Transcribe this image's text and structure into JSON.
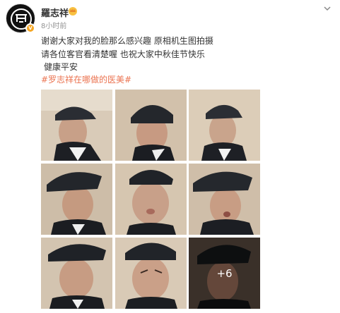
{
  "post": {
    "author": "羅志祥",
    "timestamp": "8小时前",
    "lines": [
      "谢谢大家对我的脸那么感兴趣 原相机生图拍摄",
      "请各位客官看清楚喔 也祝大家中秋佳节快乐",
      "健康平安"
    ],
    "hashtag": "#罗志祥在哪做的医美#",
    "more_photos": "+6",
    "photo_count_shown": 9
  },
  "colors": {
    "hashtag": "#eb7350",
    "verified_badge": "#f5a623",
    "timestamp": "#939393"
  },
  "icons": [
    "avatar-logo-icon",
    "crown-icon",
    "more-chevron-icon"
  ]
}
